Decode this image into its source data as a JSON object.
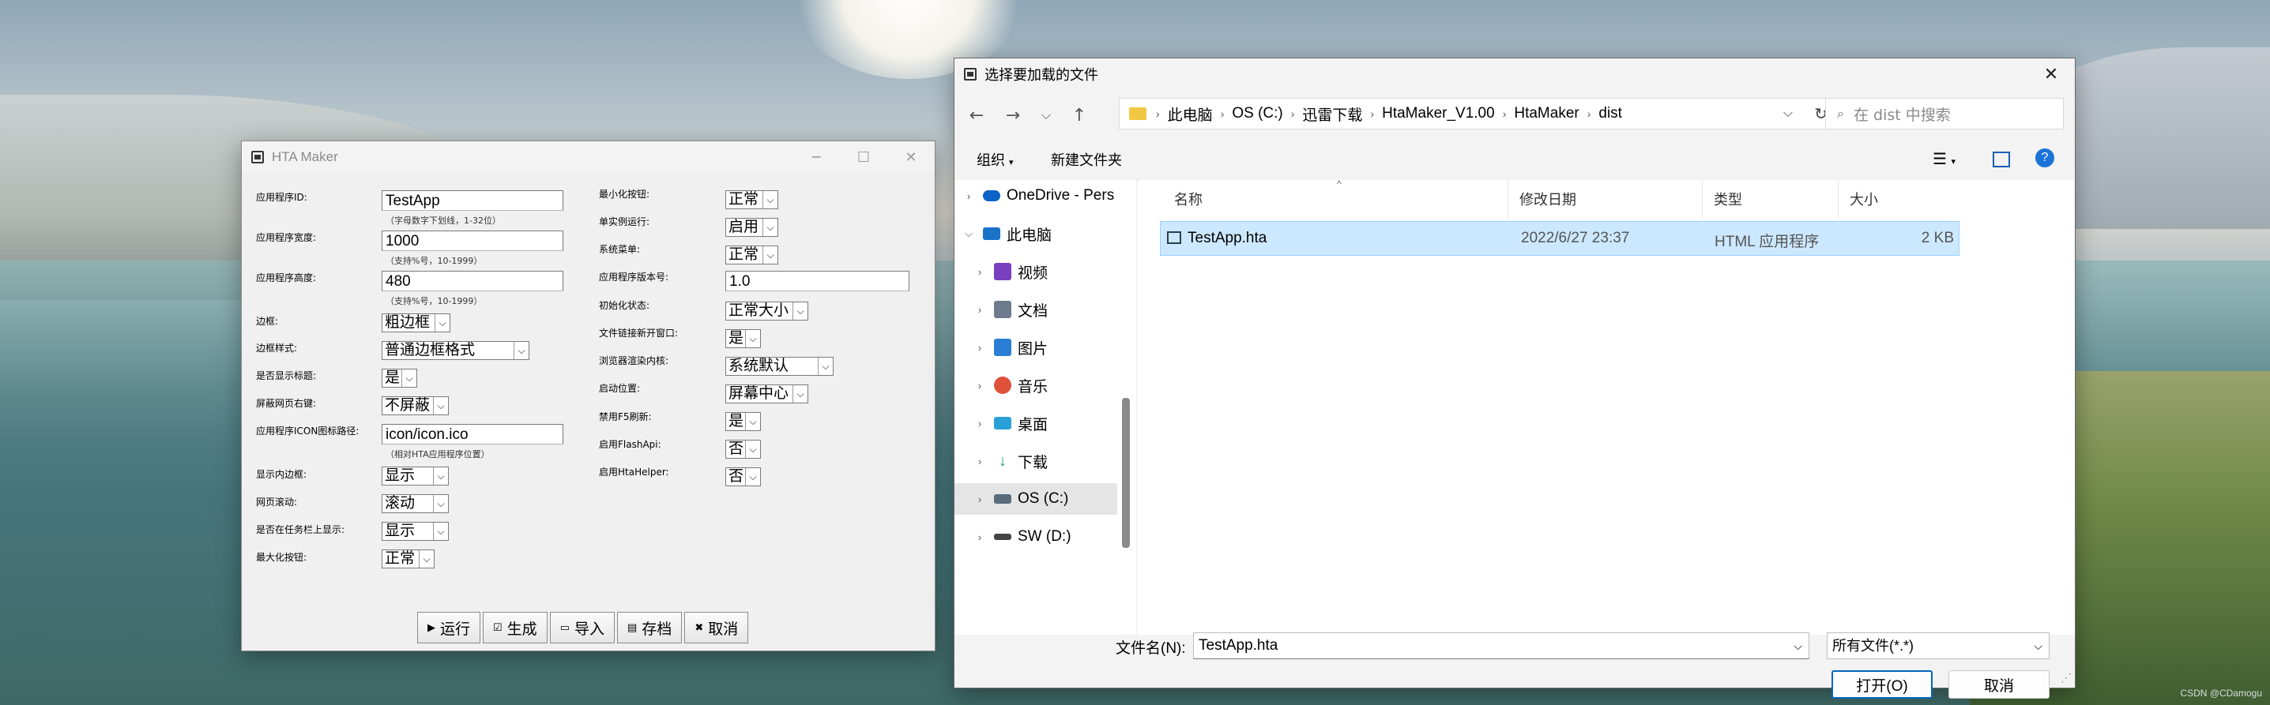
{
  "hta": {
    "title": "HTA Maker",
    "left_fields": [
      {
        "label": "应用程序ID:",
        "value": "TestApp",
        "hint": "（字母数字下划线，1-32位）"
      },
      {
        "label": "应用程序宽度:",
        "value": "1000",
        "hint": "（支持%号，10-1999）"
      },
      {
        "label": "应用程序高度:",
        "value": "480",
        "hint": "（支持%号，10-1999）"
      }
    ],
    "border_label": "边框:",
    "border_value": "粗边框",
    "border_style_label": "边框样式:",
    "border_style_value": "普通边框格式",
    "show_title_label": "是否显示标题:",
    "show_title_value": "是",
    "block_rightclick_label": "屏蔽网页右键:",
    "block_rightclick_value": "不屏蔽",
    "icon_label": "应用程序ICON图标路径:",
    "icon_value": "icon/icon.ico",
    "icon_hint": "（相对HTA应用程序位置）",
    "inner_border_label": "显示内边框:",
    "inner_border_value": "显示",
    "scroll_label": "网页滚动:",
    "scroll_value": "滚动",
    "taskbar_label": "是否在任务栏上显示:",
    "taskbar_value": "显示",
    "maximize_label": "最大化按钮:",
    "maximize_value": "正常",
    "right_fields": [
      {
        "label": "最小化按钮:",
        "value": "正常"
      },
      {
        "label": "单实例运行:",
        "value": "启用"
      },
      {
        "label": "系统菜单:",
        "value": "正常"
      }
    ],
    "version_label": "应用程序版本号:",
    "version_value": "1.0",
    "init_state_label": "初始化状态:",
    "init_state_value": "正常大小",
    "newwin_label": "文件链接新开窗口:",
    "newwin_value": "是",
    "engine_label": "浏览器渲染内核:",
    "engine_value": "系统默认",
    "startpos_label": "启动位置:",
    "startpos_value": "屏幕中心",
    "f5_label": "禁用F5刷新:",
    "f5_value": "是",
    "flash_label": "启用FlashApi:",
    "flash_value": "否",
    "htahelper_label": "启用HtaHelper:",
    "htahelper_value": "否",
    "buttons": {
      "run": "运行",
      "build": "生成",
      "import": "导入",
      "save": "存档",
      "cancel": "取消"
    }
  },
  "dialog": {
    "title": "选择要加载的文件",
    "breadcrumb": [
      "此电脑",
      "OS (C:)",
      "迅雷下载",
      "HtaMaker_V1.00",
      "HtaMaker",
      "dist"
    ],
    "search_placeholder": "在 dist 中搜索",
    "organize": "组织",
    "new_folder": "新建文件夹",
    "nav": [
      {
        "label": "OneDrive - Pers",
        "color": "#0a64c8"
      },
      {
        "label": "此电脑",
        "color": "#1a73c9"
      },
      {
        "label": "视频",
        "color": "#7a3fbf"
      },
      {
        "label": "文档",
        "color": "#6d7b8c"
      },
      {
        "label": "图片",
        "color": "#2a7fd4"
      },
      {
        "label": "音乐",
        "color": "#e0513a"
      },
      {
        "label": "桌面",
        "color": "#2aa0d8"
      },
      {
        "label": "下载",
        "color": "#1f9e7a"
      },
      {
        "label": "OS (C:)",
        "color": "#5a6b7b"
      },
      {
        "label": "SW (D:)",
        "color": "#444444"
      }
    ],
    "columns": {
      "name": "名称",
      "date": "修改日期",
      "type": "类型",
      "size": "大小"
    },
    "files": [
      {
        "name": "TestApp.hta",
        "date": "2022/6/27 23:37",
        "type": "HTML 应用程序",
        "size": "2 KB"
      }
    ],
    "filename_label": "文件名(N):",
    "filename_value": "TestApp.hta",
    "filetype_value": "所有文件(*.*)",
    "open_button": "打开(O)",
    "cancel_button": "取消"
  },
  "watermark": "CSDN @CDamogu"
}
